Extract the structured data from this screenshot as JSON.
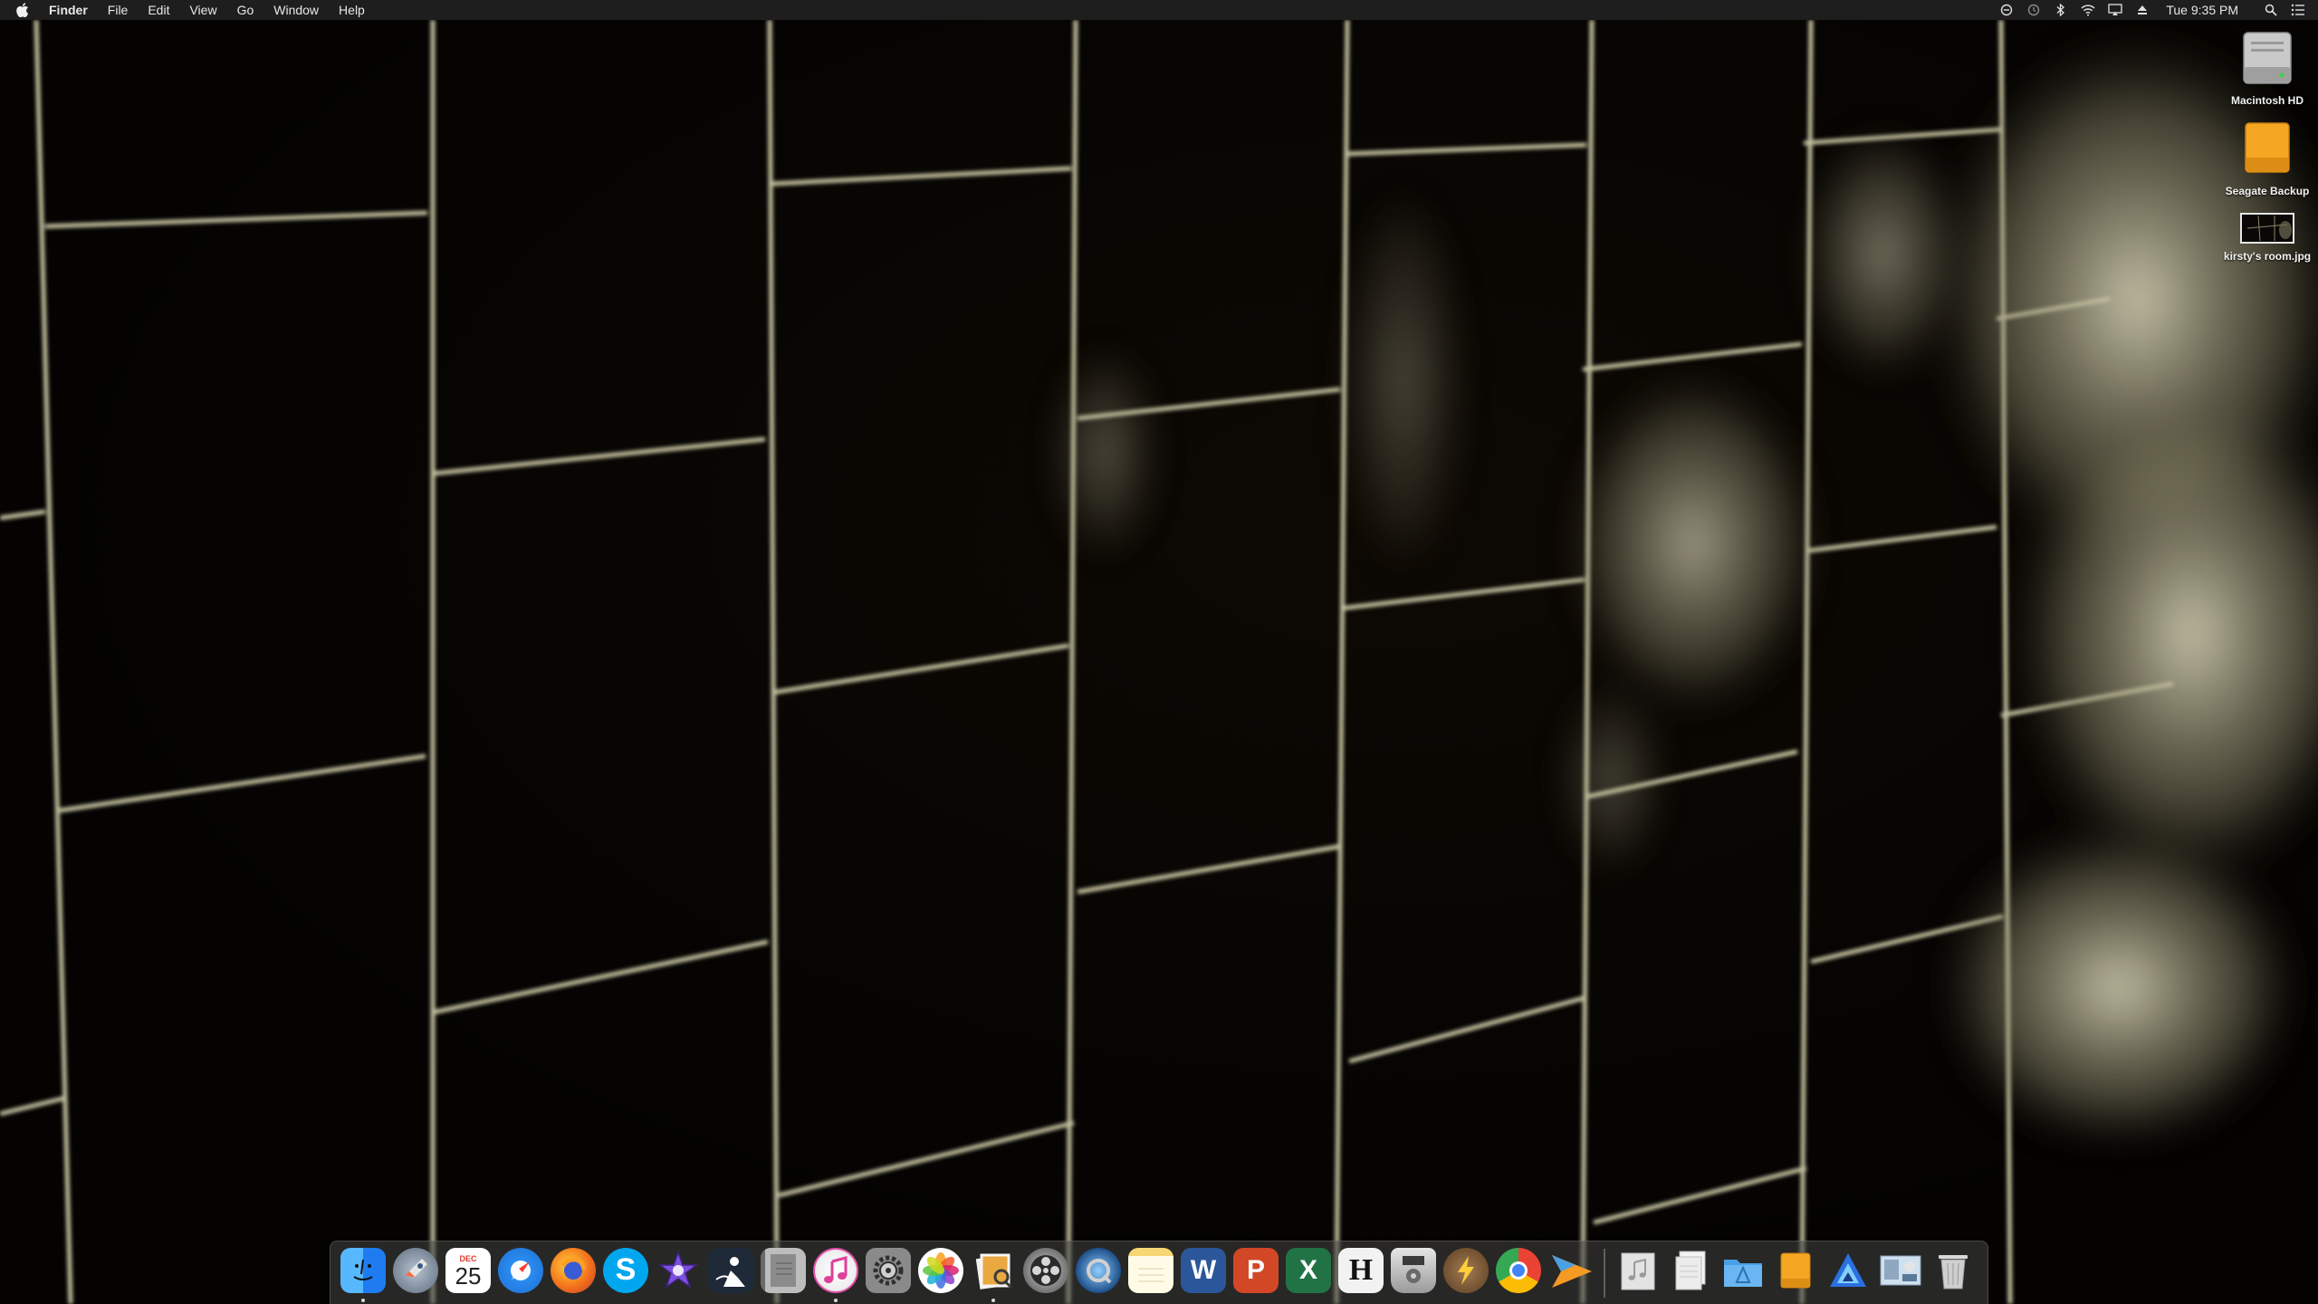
{
  "menubar": {
    "app_name": "Finder",
    "menus": [
      "File",
      "Edit",
      "View",
      "Go",
      "Window",
      "Help"
    ],
    "clock": "Tue 9:35 PM",
    "status_icons": [
      "do-not-disturb-icon",
      "time-machine-icon",
      "bluetooth-icon",
      "wifi-icon",
      "airplay-icon",
      "eject-icon",
      "spotlight-icon",
      "notification-center-icon"
    ]
  },
  "desktop": {
    "icons": [
      {
        "label": "Macintosh HD",
        "icon": "hard-drive-icon"
      },
      {
        "label": "Seagate Backup",
        "icon": "external-drive-icon"
      },
      {
        "label": "kirsty's room.jpg",
        "icon": "image-file-icon"
      }
    ]
  },
  "dock": {
    "calendar": {
      "month": "DEC",
      "day": "25"
    },
    "apps": [
      {
        "name": "Finder",
        "icon": "finder-icon",
        "color": "#1e7cf0",
        "running": true
      },
      {
        "name": "Launchpad",
        "icon": "launchpad-rocket-icon",
        "color": "#7d8a99",
        "running": false
      },
      {
        "name": "Calendar",
        "icon": "calendar-icon",
        "color": "#ffffff",
        "running": false
      },
      {
        "name": "Safari",
        "icon": "safari-compass-icon",
        "color": "#2a8cf2",
        "running": false
      },
      {
        "name": "Firefox",
        "icon": "firefox-icon",
        "color": "#f3721b",
        "running": false
      },
      {
        "name": "Skype",
        "icon": "skype-icon",
        "color": "#00a7ef",
        "running": false
      },
      {
        "name": "iMovie",
        "icon": "imovie-star-icon",
        "color": "#6b3fc4",
        "running": false
      },
      {
        "name": "Kindle",
        "icon": "kindle-reader-icon",
        "color": "#1a1a1a",
        "running": false
      },
      {
        "name": "Notebook",
        "icon": "notebook-icon",
        "color": "#9a9a9a",
        "running": false
      },
      {
        "name": "iTunes",
        "icon": "itunes-note-icon",
        "color": "#f4f4f4",
        "running": true
      },
      {
        "name": "System Preferences",
        "icon": "gear-icon",
        "color": "#8a8a8a",
        "running": false
      },
      {
        "name": "Photos",
        "icon": "photos-flower-icon",
        "color": "#f7f7f7",
        "running": false
      },
      {
        "name": "Preview",
        "icon": "preview-photos-icon",
        "color": "#e9a840",
        "running": true
      },
      {
        "name": "DVD Player",
        "icon": "film-reel-icon",
        "color": "#3a3a3a",
        "running": false
      },
      {
        "name": "QuickTime",
        "icon": "quicktime-icon",
        "color": "#1f4f8a",
        "running": false
      },
      {
        "name": "Notes",
        "icon": "notes-icon",
        "color": "#fff4b0",
        "running": false
      },
      {
        "name": "Word",
        "icon": "word-icon",
        "color": "#2b579a",
        "running": false
      },
      {
        "name": "PowerPoint",
        "icon": "powerpoint-icon",
        "color": "#d24726",
        "running": false
      },
      {
        "name": "Excel",
        "icon": "excel-icon",
        "color": "#217346",
        "running": false
      },
      {
        "name": "Hemingway",
        "icon": "hemingway-icon",
        "color": "#f2f2f2",
        "running": false
      },
      {
        "name": "DVD",
        "icon": "dvd-player-icon",
        "color": "#bdbdbd",
        "running": false
      },
      {
        "name": "Reeder",
        "icon": "bolt-icon",
        "color": "#7a5a3a",
        "running": false
      },
      {
        "name": "Chrome",
        "icon": "chrome-icon",
        "color": "#ea4335",
        "running": false
      },
      {
        "name": "Infuse",
        "icon": "infuse-icon",
        "color": "#f59a23",
        "running": false
      }
    ],
    "stacks": [
      {
        "name": "Music",
        "icon": "music-folder-icon",
        "color": "#d9d9d9"
      },
      {
        "name": "Documents",
        "icon": "documents-stack-icon",
        "color": "#e6e6e6"
      },
      {
        "name": "Applications",
        "icon": "applications-folder-icon",
        "color": "#4aa0e6"
      },
      {
        "name": "Seagate Backup",
        "icon": "external-drive-icon",
        "color": "#f5a623"
      },
      {
        "name": "Affinity",
        "icon": "affinity-icon",
        "color": "#2b6fe0"
      },
      {
        "name": "Image",
        "icon": "image-file-icon",
        "color": "#7aa0c8"
      },
      {
        "name": "Trash",
        "icon": "trash-icon",
        "color": "#cfcfcf"
      }
    ]
  }
}
